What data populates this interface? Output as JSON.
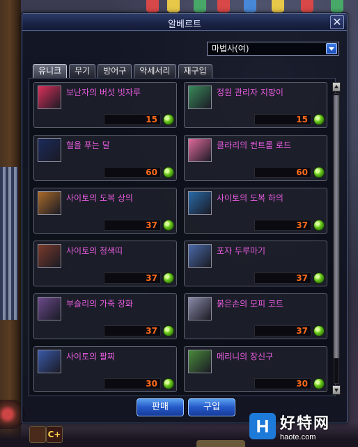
{
  "window": {
    "title": "알베르트",
    "close_label": "✕"
  },
  "job_filter": {
    "selected": "마법사(여)"
  },
  "tabs": [
    {
      "label": "유니크",
      "active": true
    },
    {
      "label": "무기",
      "active": false
    },
    {
      "label": "방어구",
      "active": false
    },
    {
      "label": "악세서리",
      "active": false
    },
    {
      "label": "재구입",
      "active": false
    }
  ],
  "items": [
    {
      "name": "보난자의 버섯 빗자루",
      "price": "15",
      "icon": "mushroom-broom-icon",
      "color": "#d8305a"
    },
    {
      "name": "정원 관리자 지팡이",
      "price": "15",
      "icon": "garden-staff-icon",
      "color": "#3a8a5a"
    },
    {
      "name": "혈을 푸는 달",
      "price": "60",
      "icon": "crescent-moon-icon",
      "color": "#1a2a5a"
    },
    {
      "name": "클라리의 컨트롤 로드",
      "price": "60",
      "icon": "flower-rod-icon",
      "color": "#e06a9a"
    },
    {
      "name": "사이토의 도복 상의",
      "price": "37",
      "icon": "dobok-top-icon",
      "color": "#a86a2a"
    },
    {
      "name": "사이토의 도복 하의",
      "price": "37",
      "icon": "dobok-bottom-icon",
      "color": "#2a6aa8"
    },
    {
      "name": "사이토의 청색띠",
      "price": "37",
      "icon": "blue-belt-icon",
      "color": "#7a3a2a"
    },
    {
      "name": "포자 두루마기",
      "price": "37",
      "icon": "spore-robe-icon",
      "color": "#4a6aa8"
    },
    {
      "name": "부슬리의 가죽 장화",
      "price": "37",
      "icon": "leather-boots-icon",
      "color": "#6a4a8a"
    },
    {
      "name": "붉은손의 모피 코트",
      "price": "37",
      "icon": "fur-coat-icon",
      "color": "#8a8aa8"
    },
    {
      "name": "사이토의 팔찌",
      "price": "30",
      "icon": "bracelet-icon",
      "color": "#3a5aa8"
    },
    {
      "name": "메리니의 장신구",
      "price": "30",
      "icon": "charm-icon",
      "color": "#4a8a3a"
    }
  ],
  "buttons": {
    "sell": "판매",
    "buy": "구입"
  },
  "hud": {
    "skill_plus": "C+"
  },
  "watermark": {
    "logo": "H",
    "text": "好特网",
    "url": "haote.com"
  },
  "colors": {
    "item_name": "#e85ce0",
    "price": "#ff6a1a",
    "button_blue": "#2458c8"
  }
}
